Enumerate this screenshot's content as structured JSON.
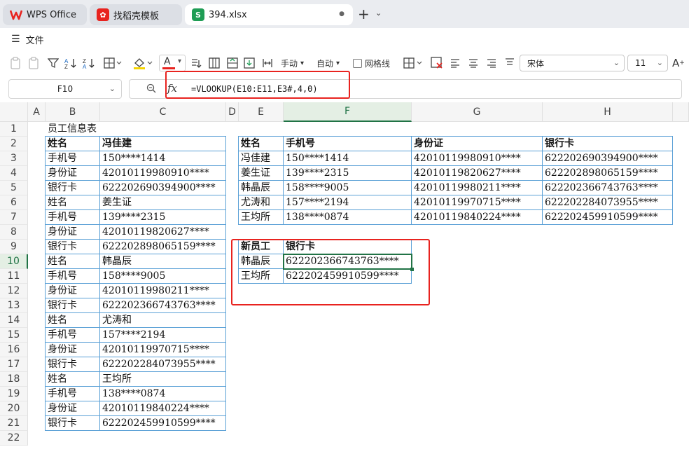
{
  "tabs": [
    {
      "label": "WPS Office",
      "icon": "wps-logo-icon"
    },
    {
      "label": "找稻壳模板",
      "icon": "docer-logo-icon"
    },
    {
      "label": "394.xlsx",
      "icon": "sheet-logo-icon",
      "close": "●"
    }
  ],
  "menu": {
    "file_label": "文件"
  },
  "toolbar": {
    "manual_label": "手动",
    "auto_label": "自动",
    "gridlines_label": "网格线",
    "font_name": "宋体",
    "font_size": "11",
    "font_color_glyph": "A"
  },
  "formula_bar": {
    "cell_ref": "F10",
    "fx_label": "fx",
    "formula": "=VLOOKUP(E10:E11,E3#,4,0)"
  },
  "grid": {
    "columns": [
      "A",
      "B",
      "C",
      "D",
      "E",
      "F",
      "G",
      "H"
    ],
    "rows": [
      "1",
      "2",
      "3",
      "4",
      "5",
      "6",
      "7",
      "8",
      "9",
      "10",
      "11",
      "12",
      "13",
      "14",
      "15",
      "16",
      "17",
      "18",
      "19",
      "20",
      "21",
      "22"
    ],
    "selected_column": "F",
    "selected_row": "10"
  },
  "sheet_title": "员工信息表",
  "left_table": [
    [
      "姓名",
      "冯佳建"
    ],
    [
      "手机号",
      "150****1414"
    ],
    [
      "身份证",
      "42010119980910****"
    ],
    [
      "银行卡",
      "622202690394900****"
    ],
    [
      "姓名",
      "姜生证"
    ],
    [
      "手机号",
      "139****2315"
    ],
    [
      "身份证",
      "42010119820627****"
    ],
    [
      "银行卡",
      "622202898065159****"
    ],
    [
      "姓名",
      "韩晶辰"
    ],
    [
      "手机号",
      "158****9005"
    ],
    [
      "身份证",
      "42010119980211****"
    ],
    [
      "银行卡",
      "622202366743763****"
    ],
    [
      "姓名",
      "尤涛和"
    ],
    [
      "手机号",
      "157****2194"
    ],
    [
      "身份证",
      "42010119970715****"
    ],
    [
      "银行卡",
      "622202284073955****"
    ],
    [
      "姓名",
      "王均所"
    ],
    [
      "手机号",
      "138****0874"
    ],
    [
      "身份证",
      "42010119840224****"
    ],
    [
      "银行卡",
      "622202459910599****"
    ]
  ],
  "right_table": {
    "headers": [
      "姓名",
      "手机号",
      "身份证",
      "银行卡"
    ],
    "rows": [
      [
        "冯佳建",
        "150****1414",
        "42010119980910****",
        "622202690394900****"
      ],
      [
        "姜生证",
        "139****2315",
        "42010119820627****",
        "622202898065159****"
      ],
      [
        "韩晶辰",
        "158****9005",
        "42010119980211****",
        "622202366743763****"
      ],
      [
        "尤涛和",
        "157****2194",
        "42010119970715****",
        "622202284073955****"
      ],
      [
        "王均所",
        "138****0874",
        "42010119840224****",
        "622202459910599****"
      ]
    ]
  },
  "lookup_table": {
    "headers": [
      "新员工",
      "银行卡"
    ],
    "rows": [
      [
        "韩晶辰",
        "622202366743763****"
      ],
      [
        "王均所",
        "622202459910599****"
      ]
    ]
  },
  "colors": {
    "accent": "#217346",
    "highlight": "#e8231f",
    "border": "#5aa0d6"
  }
}
